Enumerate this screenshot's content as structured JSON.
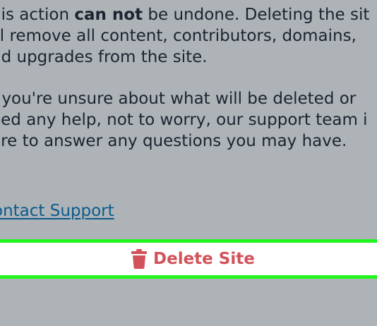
{
  "warning": {
    "line1_before": "his action ",
    "line1_bold": "can not",
    "line1_after": " be undone. Deleting the sit",
    "line2": "ill remove all content, contributors, domains,",
    "line3": "nd upgrades from the site."
  },
  "support_note": {
    "line1": "f you're unsure about what will be deleted or",
    "line2": "eed any help, not to worry, our support team i",
    "line3": "ere to answer any questions you may have."
  },
  "contact_link": "ontact Support",
  "delete_button": {
    "label": "Delete Site",
    "icon": "trash-icon"
  },
  "colors": {
    "background": "#aeb3b7",
    "text": "#1c2430",
    "link": "#0b5a8c",
    "danger": "#d2525a",
    "highlight_border": "#22f51e"
  }
}
